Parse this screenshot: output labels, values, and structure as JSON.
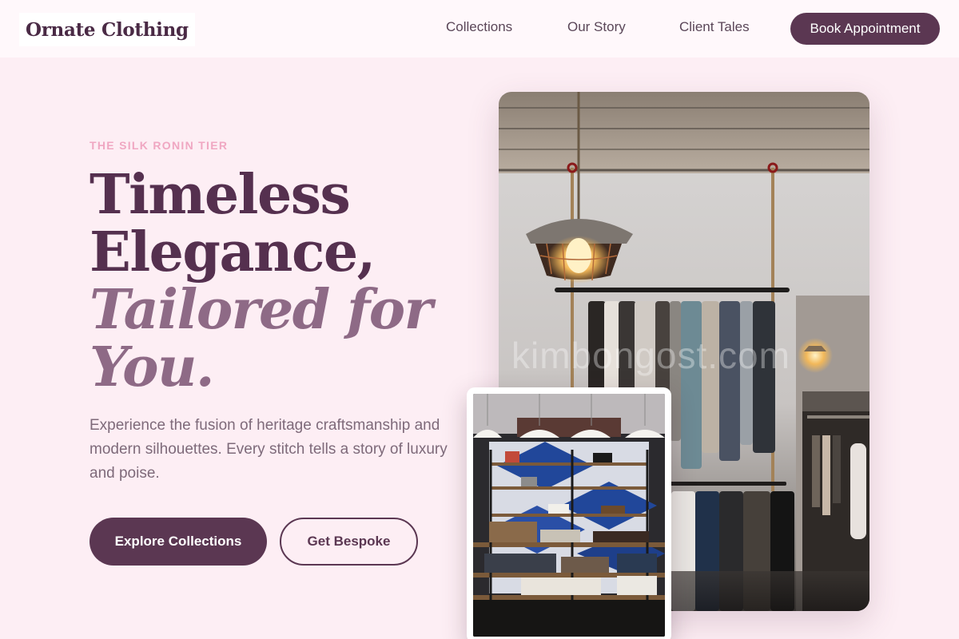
{
  "brand": {
    "name": "Ornate Clothing"
  },
  "nav": {
    "links": [
      {
        "label": "Collections"
      },
      {
        "label": "Our Story"
      },
      {
        "label": "Client Tales"
      }
    ],
    "cta_label": "Book Appointment"
  },
  "hero": {
    "eyebrow": "THE SILK RONIN TIER",
    "headline_lines": [
      "Timeless",
      "Elegance,",
      "Tailored for",
      "You."
    ],
    "lead": "Experience the fusion of heritage craftsmanship and modern silhouettes. Every stitch tells a story of luxury and poise.",
    "primary_cta": "Explore Collections",
    "secondary_cta": "Get Bespoke"
  },
  "images": {
    "main_watermark": "kimbongost.com",
    "inset_watermark": "kimbongost.com"
  },
  "colors": {
    "background": "#fdeef4",
    "header": "#fff8fb",
    "brand_plum": "#5b3752",
    "accent_pink": "#f0a7c2",
    "italic_mauve": "#8e6a86"
  }
}
